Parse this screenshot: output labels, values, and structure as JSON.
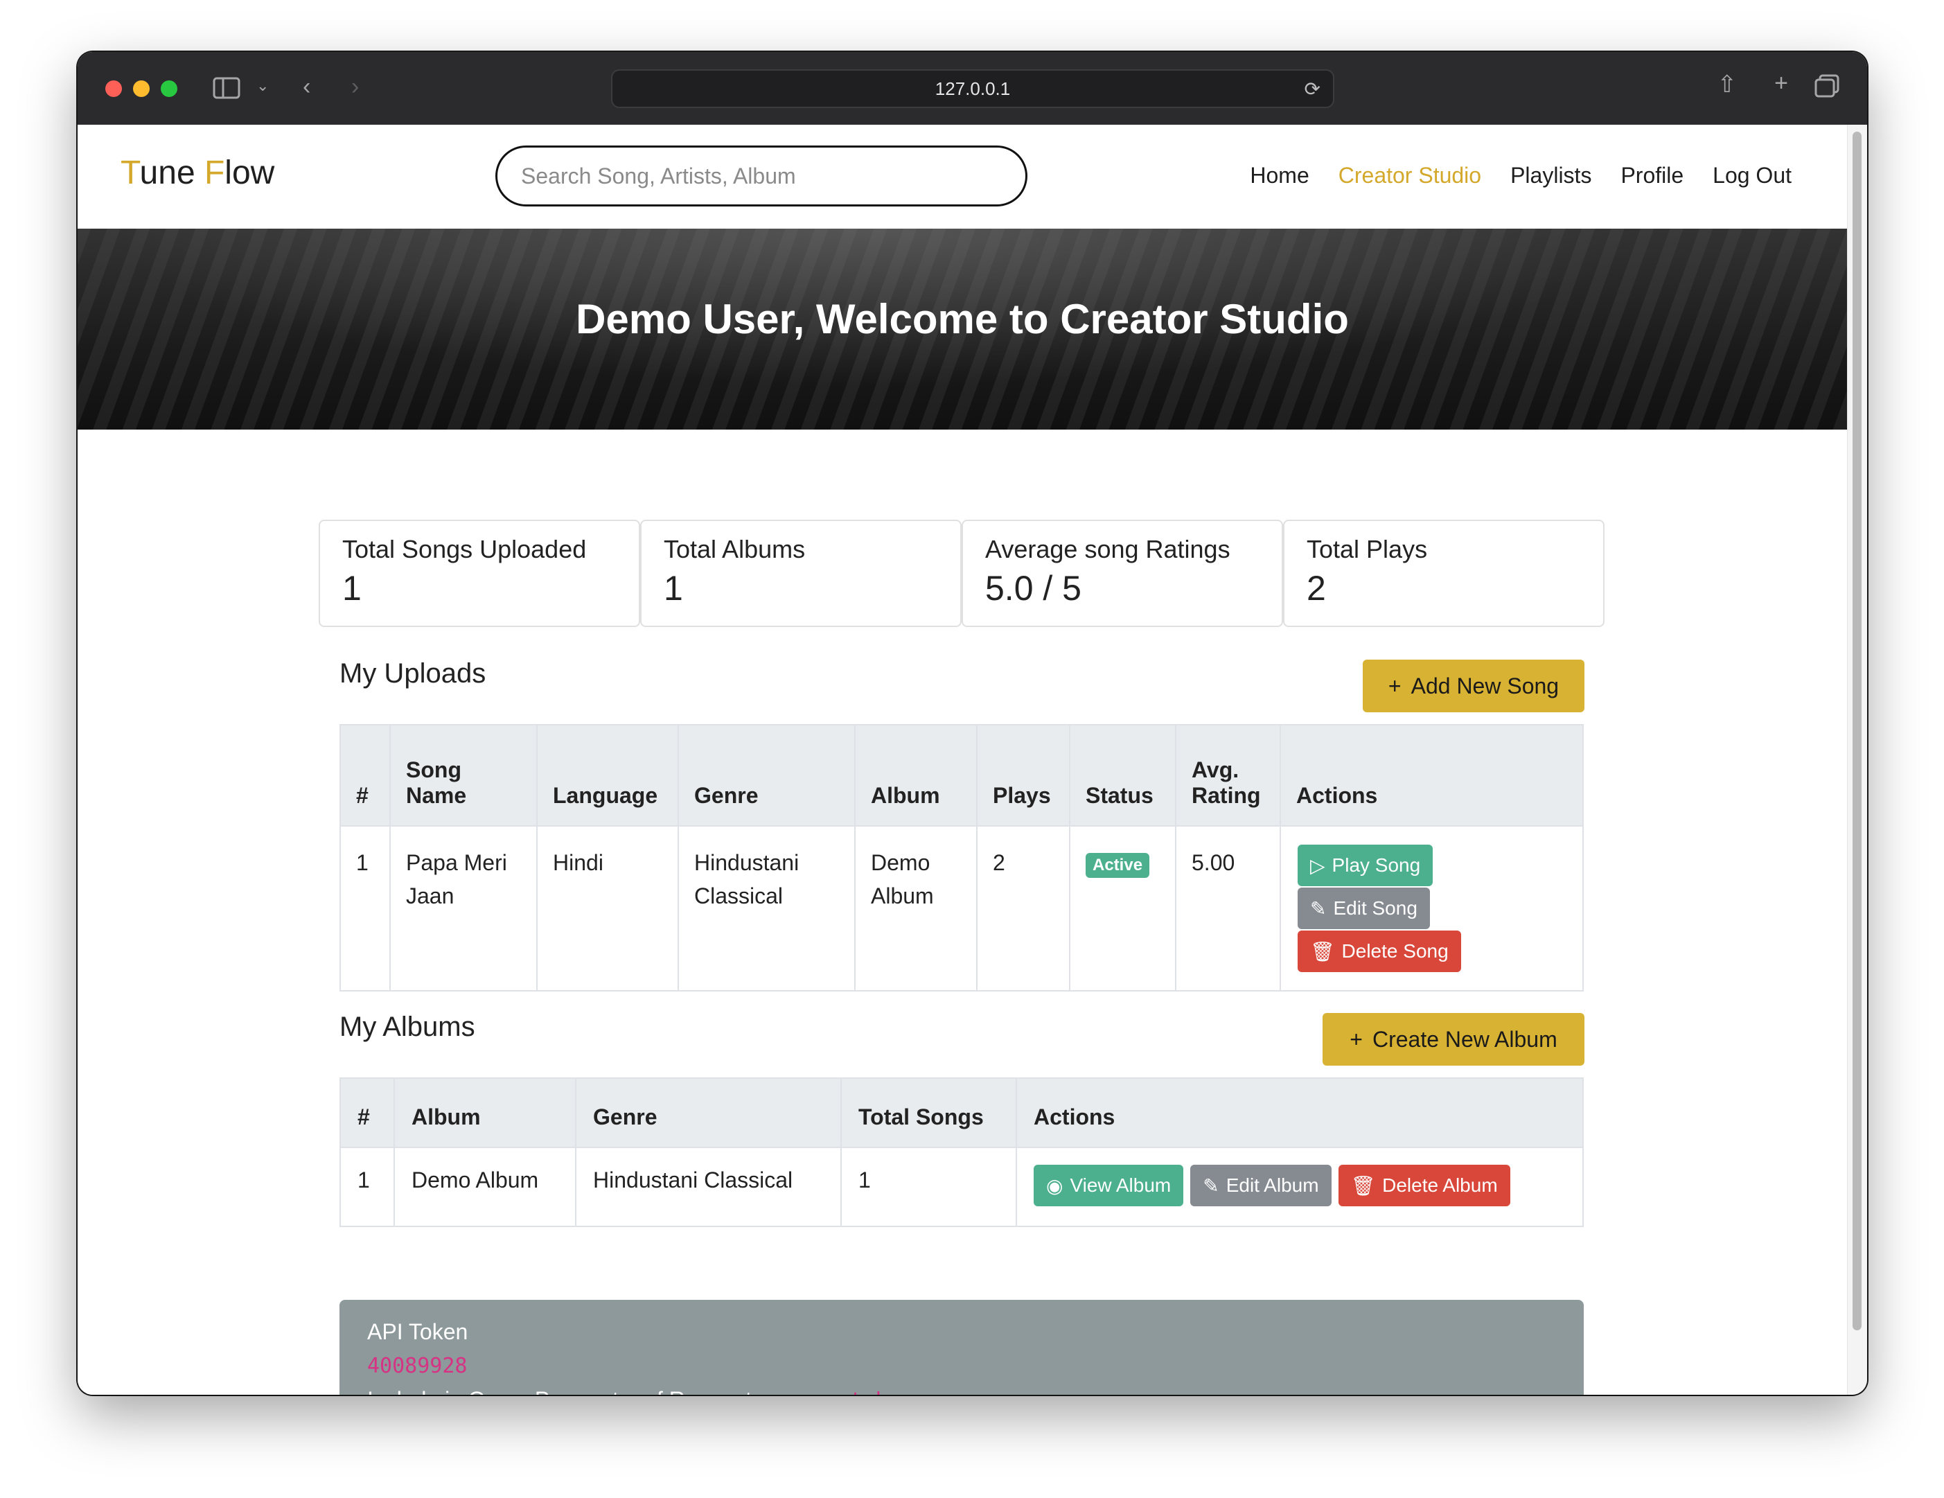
{
  "browser": {
    "url": "127.0.0.1"
  },
  "navbar": {
    "brand_first_letter": "T",
    "brand_first_rest": "une ",
    "brand_second_letter": "F",
    "brand_second_rest": "low",
    "search_placeholder": "Search Song, Artists, Album",
    "links": [
      "Home",
      "Creator Studio",
      "Playlists",
      "Profile",
      "Log Out"
    ],
    "active_link": "Creator Studio"
  },
  "hero": {
    "title": "Demo User, Welcome to Creator Studio"
  },
  "stats": [
    {
      "label": "Total Songs Uploaded",
      "value": "1"
    },
    {
      "label": "Total Albums",
      "value": "1"
    },
    {
      "label": "Average song Ratings",
      "value": "5.0 / 5"
    },
    {
      "label": "Total Plays",
      "value": "2"
    }
  ],
  "uploads": {
    "title": "My Uploads",
    "add_button": "Add New Song",
    "headers": [
      "#",
      "Song Name",
      "Language",
      "Genre",
      "Album",
      "Plays",
      "Status",
      "Avg. Rating",
      "Actions"
    ],
    "rows": [
      {
        "num": "1",
        "song_name": "Papa Meri Jaan",
        "language": "Hindi",
        "genre": "Hindustani Classical",
        "album": "Demo Album",
        "plays": "2",
        "status": "Active",
        "avg_rating": "5.00",
        "play_label": "Play Song",
        "edit_label": "Edit Song",
        "delete_label": "Delete Song"
      }
    ]
  },
  "albums": {
    "title": "My Albums",
    "create_button": "Create New Album",
    "headers": [
      "#",
      "Album",
      "Genre",
      "Total Songs",
      "Actions"
    ],
    "rows": [
      {
        "num": "1",
        "album": "Demo Album",
        "genre": "Hindustani Classical",
        "total_songs": "1",
        "view_label": "View Album",
        "edit_label": "Edit Album",
        "delete_label": "Delete Album"
      }
    ]
  },
  "api": {
    "title": "API Token",
    "token": "40089928",
    "hint": "Include in Query Parameter of Request as",
    "param": "user_token"
  },
  "colors": {
    "accent": "#d4a82b",
    "success": "#4caf8d",
    "secondary": "#858b91",
    "danger": "#d9473a",
    "warning": "#d8b232"
  },
  "icons": {
    "plus": "plus-icon",
    "play": "play-icon",
    "edit": "pencil-icon",
    "delete": "trash-icon",
    "view": "eye-icon"
  }
}
